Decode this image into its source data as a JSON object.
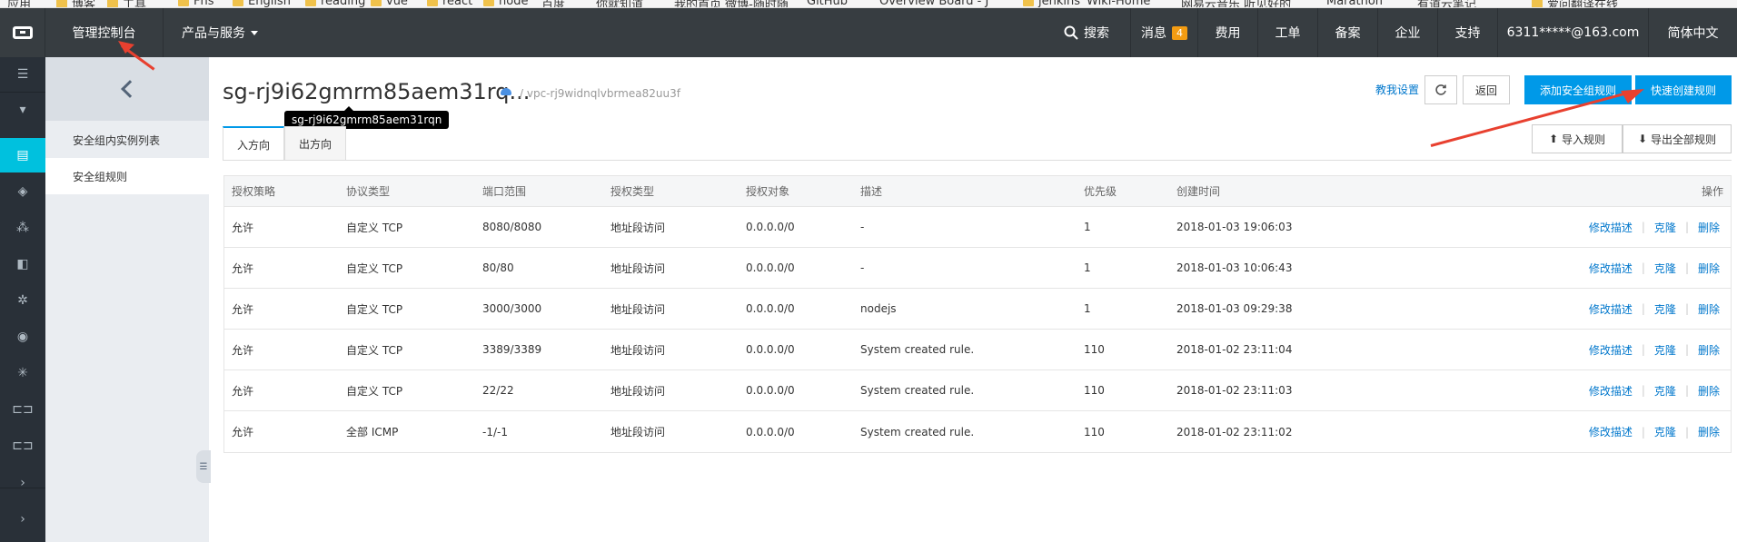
{
  "bookmarks": [
    "应用",
    "博客",
    "工具",
    "Fhs",
    "English",
    "reading",
    "vue",
    "react",
    "node",
    "百度",
    "你就知道",
    "我的首页 微博-随时随",
    "GitHub",
    "Overview Board - J",
    "jenkins",
    "Wiki-Home",
    "网易云音乐 听见好的",
    "Marathon",
    "有道云笔记",
    "爱问翻译在线"
  ],
  "topbar": {
    "console": "管理控制台",
    "products": "产品与服务",
    "search": "搜索",
    "messages": "消息",
    "message_count": "4",
    "fees": "费用",
    "tickets": "工单",
    "filing": "备案",
    "enterprise": "企业",
    "support": "支持",
    "account": "6311*****@163.com",
    "language": "简体中文"
  },
  "sidebar": {
    "items": [
      {
        "label": "安全组内实例列表"
      },
      {
        "label": "安全组规则"
      }
    ]
  },
  "header": {
    "title": "sg-rj9i62gmrm85aem31rq...",
    "vpc": "/ vpc-rj9widnqlvbrmea82uu3f",
    "tooltip": "sg-rj9i62gmrm85aem31rqn",
    "tutorial": "教我设置",
    "back": "返回",
    "add_rule": "添加安全组规则",
    "quick_create": "快速创建规则"
  },
  "tabs": [
    "入方向",
    "出方向"
  ],
  "toolbar": {
    "import": "导入规则",
    "export": "导出全部规则"
  },
  "table": {
    "columns": [
      "授权策略",
      "协议类型",
      "端口范围",
      "授权类型",
      "授权对象",
      "描述",
      "优先级",
      "创建时间",
      "操作"
    ],
    "rows": [
      {
        "policy": "允许",
        "protocol": "自定义 TCP",
        "port": "8080/8080",
        "auth_type": "地址段访问",
        "target": "0.0.0.0/0",
        "desc": "-",
        "priority": "1",
        "created": "2018-01-03 19:06:03"
      },
      {
        "policy": "允许",
        "protocol": "自定义 TCP",
        "port": "80/80",
        "auth_type": "地址段访问",
        "target": "0.0.0.0/0",
        "desc": "-",
        "priority": "1",
        "created": "2018-01-03 10:06:43"
      },
      {
        "policy": "允许",
        "protocol": "自定义 TCP",
        "port": "3000/3000",
        "auth_type": "地址段访问",
        "target": "0.0.0.0/0",
        "desc": "nodejs",
        "priority": "1",
        "created": "2018-01-03 09:29:38"
      },
      {
        "policy": "允许",
        "protocol": "自定义 TCP",
        "port": "3389/3389",
        "auth_type": "地址段访问",
        "target": "0.0.0.0/0",
        "desc": "System created rule.",
        "priority": "110",
        "created": "2018-01-02 23:11:04"
      },
      {
        "policy": "允许",
        "protocol": "自定义 TCP",
        "port": "22/22",
        "auth_type": "地址段访问",
        "target": "0.0.0.0/0",
        "desc": "System created rule.",
        "priority": "110",
        "created": "2018-01-02 23:11:03"
      },
      {
        "policy": "允许",
        "protocol": "全部 ICMP",
        "port": "-1/-1",
        "auth_type": "地址段访问",
        "target": "0.0.0.0/0",
        "desc": "System created rule.",
        "priority": "110",
        "created": "2018-01-02 23:11:02"
      }
    ],
    "actions": [
      "修改描述",
      "克隆",
      "删除"
    ]
  }
}
